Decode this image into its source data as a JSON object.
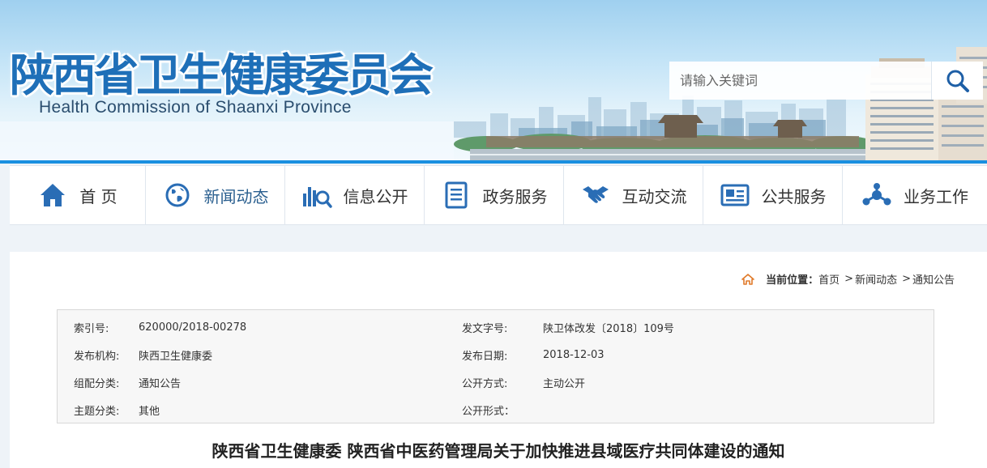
{
  "header": {
    "title": "陕西省卫生健康委员会",
    "subtitle": "Health Commission of Shaanxi Province",
    "search": {
      "placeholder": "请输入关键词"
    }
  },
  "nav": {
    "items": [
      {
        "label": "首 页",
        "icon": "home-icon"
      },
      {
        "label": "新闻动态",
        "icon": "globe-icon"
      },
      {
        "label": "信息公开",
        "icon": "chart-search-icon"
      },
      {
        "label": "政务服务",
        "icon": "document-icon"
      },
      {
        "label": "互动交流",
        "icon": "handshake-icon"
      },
      {
        "label": "公共服务",
        "icon": "newspaper-icon"
      },
      {
        "label": "业务工作",
        "icon": "network-icon"
      }
    ]
  },
  "breadcrumb": {
    "label": "当前位置：",
    "items": [
      "首页",
      "新闻动态",
      "通知公告"
    ],
    "separator": ">"
  },
  "meta": {
    "rows": [
      {
        "k1": "索引号:",
        "v1": "620000/2018-00278",
        "k2": "发文字号:",
        "v2": "陕卫体改发〔2018〕109号"
      },
      {
        "k1": "发布机构:",
        "v1": "陕西卫生健康委",
        "k2": "发布日期:",
        "v2": "2018-12-03"
      },
      {
        "k1": "组配分类:",
        "v1": "通知公告",
        "k2": "公开方式:",
        "v2": "主动公开"
      },
      {
        "k1": "主题分类:",
        "v1": "其他",
        "k2": "公开形式：",
        "v2": ""
      }
    ]
  },
  "article": {
    "title": "陕西省卫生健康委 陕西省中医药管理局关于加快推进县域医疗共同体建设的通知"
  },
  "colors": {
    "brand_blue": "#1e6fb8",
    "accent_bar": "#1a8fe0",
    "icon_blue": "#2a6db5"
  }
}
